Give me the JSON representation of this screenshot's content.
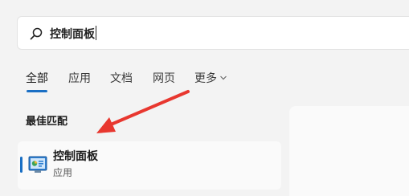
{
  "search": {
    "query": "控制面板"
  },
  "tabs": [
    {
      "label": "全部"
    },
    {
      "label": "应用"
    },
    {
      "label": "文档"
    },
    {
      "label": "网页"
    },
    {
      "label": "更多"
    }
  ],
  "section": {
    "heading": "最佳匹配"
  },
  "best_match": {
    "title": "控制面板",
    "subtitle": "应用",
    "icon": "control-panel-icon"
  },
  "colors": {
    "accent": "#1a6fc4",
    "annotation_arrow": "#e8372f"
  }
}
